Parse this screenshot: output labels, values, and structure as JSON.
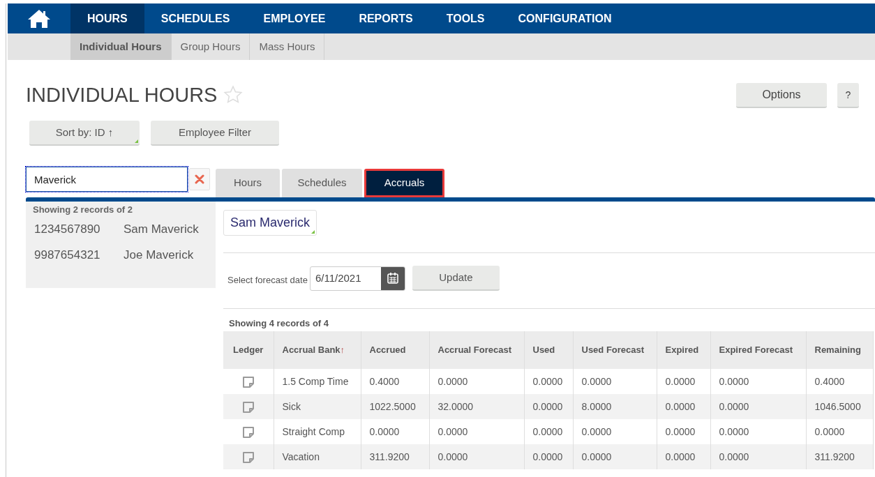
{
  "nav": {
    "items": [
      {
        "label": "HOURS",
        "selected": true
      },
      {
        "label": "SCHEDULES",
        "selected": false
      },
      {
        "label": "EMPLOYEE",
        "selected": false
      },
      {
        "label": "REPORTS",
        "selected": false
      },
      {
        "label": "TOOLS",
        "selected": false
      },
      {
        "label": "CONFIGURATION",
        "selected": false
      }
    ]
  },
  "subnav": {
    "items": [
      {
        "label": "Individual Hours",
        "selected": true
      },
      {
        "label": "Group Hours",
        "selected": false
      },
      {
        "label": "Mass Hours",
        "selected": false
      }
    ]
  },
  "page": {
    "title": "INDIVIDUAL HOURS",
    "favorite": false,
    "buttons": [
      "Options",
      "?"
    ]
  },
  "toolbar": {
    "sort": "Sort by: ID ↑",
    "filter": "Employee Filter"
  },
  "search": {
    "value": "Maverick"
  },
  "employee_list": {
    "count": "Showing 2 records of 2",
    "rows": [
      {
        "id": "1234567890",
        "name": "Sam Maverick"
      },
      {
        "id": "9987654321",
        "name": "Joe Maverick"
      }
    ]
  },
  "tabs": [
    {
      "label": "Hours",
      "selected": false,
      "highlighted": false
    },
    {
      "label": "Schedules",
      "selected": false,
      "highlighted": false
    },
    {
      "label": "Accruals",
      "selected": true,
      "highlighted": true
    }
  ],
  "employee_button": "Sam Maverick",
  "forecast": {
    "label": "Select forecast date",
    "value": "6/11/2021",
    "button": "Update"
  },
  "table": {
    "count": "Showing 4 records of 4",
    "columns": [
      {
        "label": "Ledger"
      },
      {
        "label": "Accrual Bank",
        "sort": "↑"
      },
      {
        "label": "Accrued"
      },
      {
        "label": "Accrual Forecast"
      },
      {
        "label": "Used"
      },
      {
        "label": "Used Forecast"
      },
      {
        "label": "Expired"
      },
      {
        "label": "Expired Forecast"
      },
      {
        "label": "Remaining"
      }
    ],
    "rows": [
      [
        {
          "kind": "note"
        },
        "1.5 Comp Time",
        "0.4000",
        "0.0000",
        "0.0000",
        "0.0000",
        "0.0000",
        "0.0000",
        "0.4000"
      ],
      [
        {
          "kind": "note"
        },
        "Sick",
        "1022.5000",
        "32.0000",
        "0.0000",
        "8.0000",
        "0.0000",
        "0.0000",
        "1046.5000"
      ],
      [
        {
          "kind": "note"
        },
        "Straight Comp",
        "0.0000",
        "0.0000",
        "0.0000",
        "0.0000",
        "0.0000",
        "0.0000",
        "0.0000"
      ],
      [
        {
          "kind": "note"
        },
        "Vacation",
        "311.9200",
        "0.0000",
        "0.0000",
        "0.0000",
        "0.0000",
        "0.0000",
        "311.9200"
      ]
    ]
  }
}
